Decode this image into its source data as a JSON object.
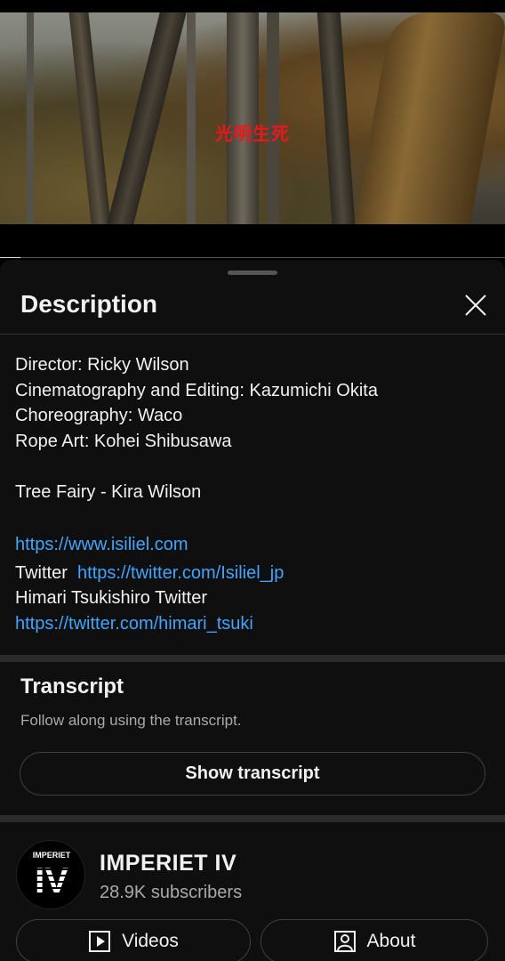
{
  "video": {
    "caption": "光明生死",
    "progress_fraction": 0.04
  },
  "sheet": {
    "title": "Description",
    "description_lines": [
      "Director: Ricky Wilson",
      "Cinematography and Editing: Kazumichi Okita",
      "Choreography: Waco",
      "Rope Art: Kohei Shibusawa",
      "Tree Fairy - Kira Wilson"
    ],
    "links": {
      "website": "https://www.isiliel.com",
      "twitter_label": "Twitter",
      "twitter_url": "https://twitter.com/Isiliel_jp",
      "himari_label": "Himari Tsukishiro Twitter",
      "himari_url": "https://twitter.com/himari_tsuki"
    }
  },
  "transcript": {
    "title": "Transcript",
    "subtitle": "Follow along using the transcript.",
    "button_label": "Show transcript"
  },
  "channel": {
    "name": "IMPERIET IV",
    "subscribers": "28.9K subscribers",
    "avatar_text_top": "IMPERIET",
    "avatar_text_main": "IV",
    "videos_label": "Videos",
    "about_label": "About"
  },
  "icons": {
    "close": "close-icon",
    "videos": "play-box-icon",
    "about": "person-box-icon"
  },
  "colors": {
    "link": "#3ea6ff",
    "caption": "#e8181c",
    "background": "#0f0f0f"
  }
}
